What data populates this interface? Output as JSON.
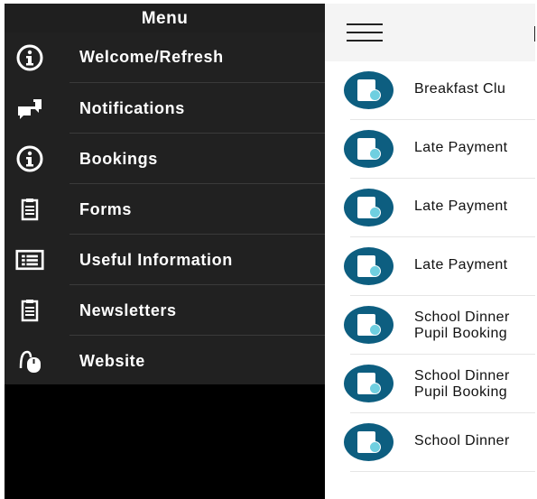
{
  "drawer": {
    "title": "Menu",
    "items": [
      {
        "label": "Welcome/Refresh",
        "icon": "info-icon"
      },
      {
        "label": "Notifications",
        "icon": "chat-bubbles-icon"
      },
      {
        "label": "Bookings",
        "icon": "info-icon"
      },
      {
        "label": "Forms",
        "icon": "clipboard-icon"
      },
      {
        "label": "Useful Information",
        "icon": "list-card-icon"
      },
      {
        "label": "Newsletters",
        "icon": "clipboard-icon"
      },
      {
        "label": "Website",
        "icon": "mouse-icon"
      }
    ]
  },
  "list": {
    "items": [
      {
        "line1": "Breakfast Clu",
        "line2": ""
      },
      {
        "line1": "Late Payment",
        "line2": ""
      },
      {
        "line1": "Late Payment",
        "line2": ""
      },
      {
        "line1": "Late Payment",
        "line2": ""
      },
      {
        "line1": "School Dinner",
        "line2": "Pupil Booking"
      },
      {
        "line1": "School Dinner",
        "line2": "Pupil Booking"
      },
      {
        "line1": "School Dinner",
        "line2": ""
      }
    ]
  },
  "colors": {
    "drawer_bg": "#212121",
    "avatar": "#0d5e80",
    "check": "#6fcfe0"
  }
}
